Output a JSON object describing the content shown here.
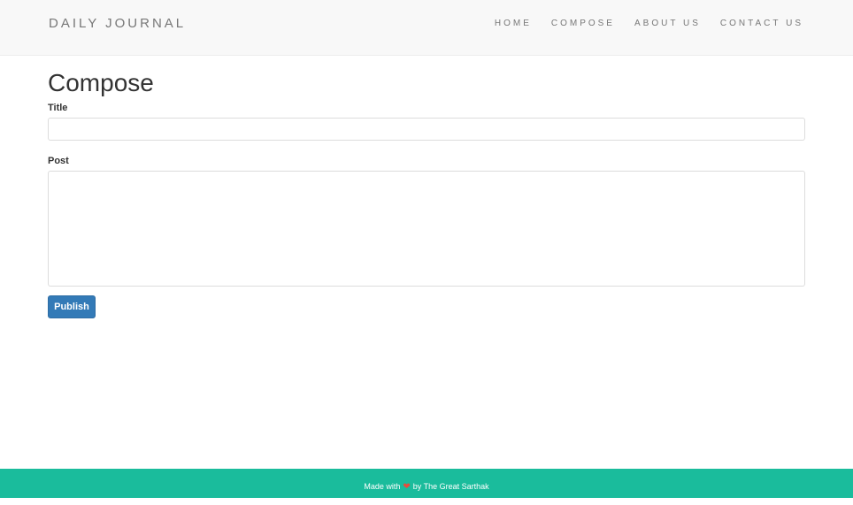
{
  "navbar": {
    "brand": "DAILY JOURNAL",
    "links": [
      {
        "label": "HOME"
      },
      {
        "label": "COMPOSE"
      },
      {
        "label": "ABOUT US"
      },
      {
        "label": "CONTACT US"
      }
    ]
  },
  "main": {
    "page_title": "Compose",
    "title_label": "Title",
    "title_value": "",
    "post_label": "Post",
    "post_value": "",
    "publish_label": "Publish"
  },
  "footer": {
    "text_before": "Made with",
    "icon": "heart-icon",
    "text_after": "by The Great Sarthak",
    "heart_color": "#e74c3c",
    "background": "#1abc9c"
  },
  "colors": {
    "primary_button": "#337ab7",
    "navbar_bg": "#f8f8f8"
  }
}
